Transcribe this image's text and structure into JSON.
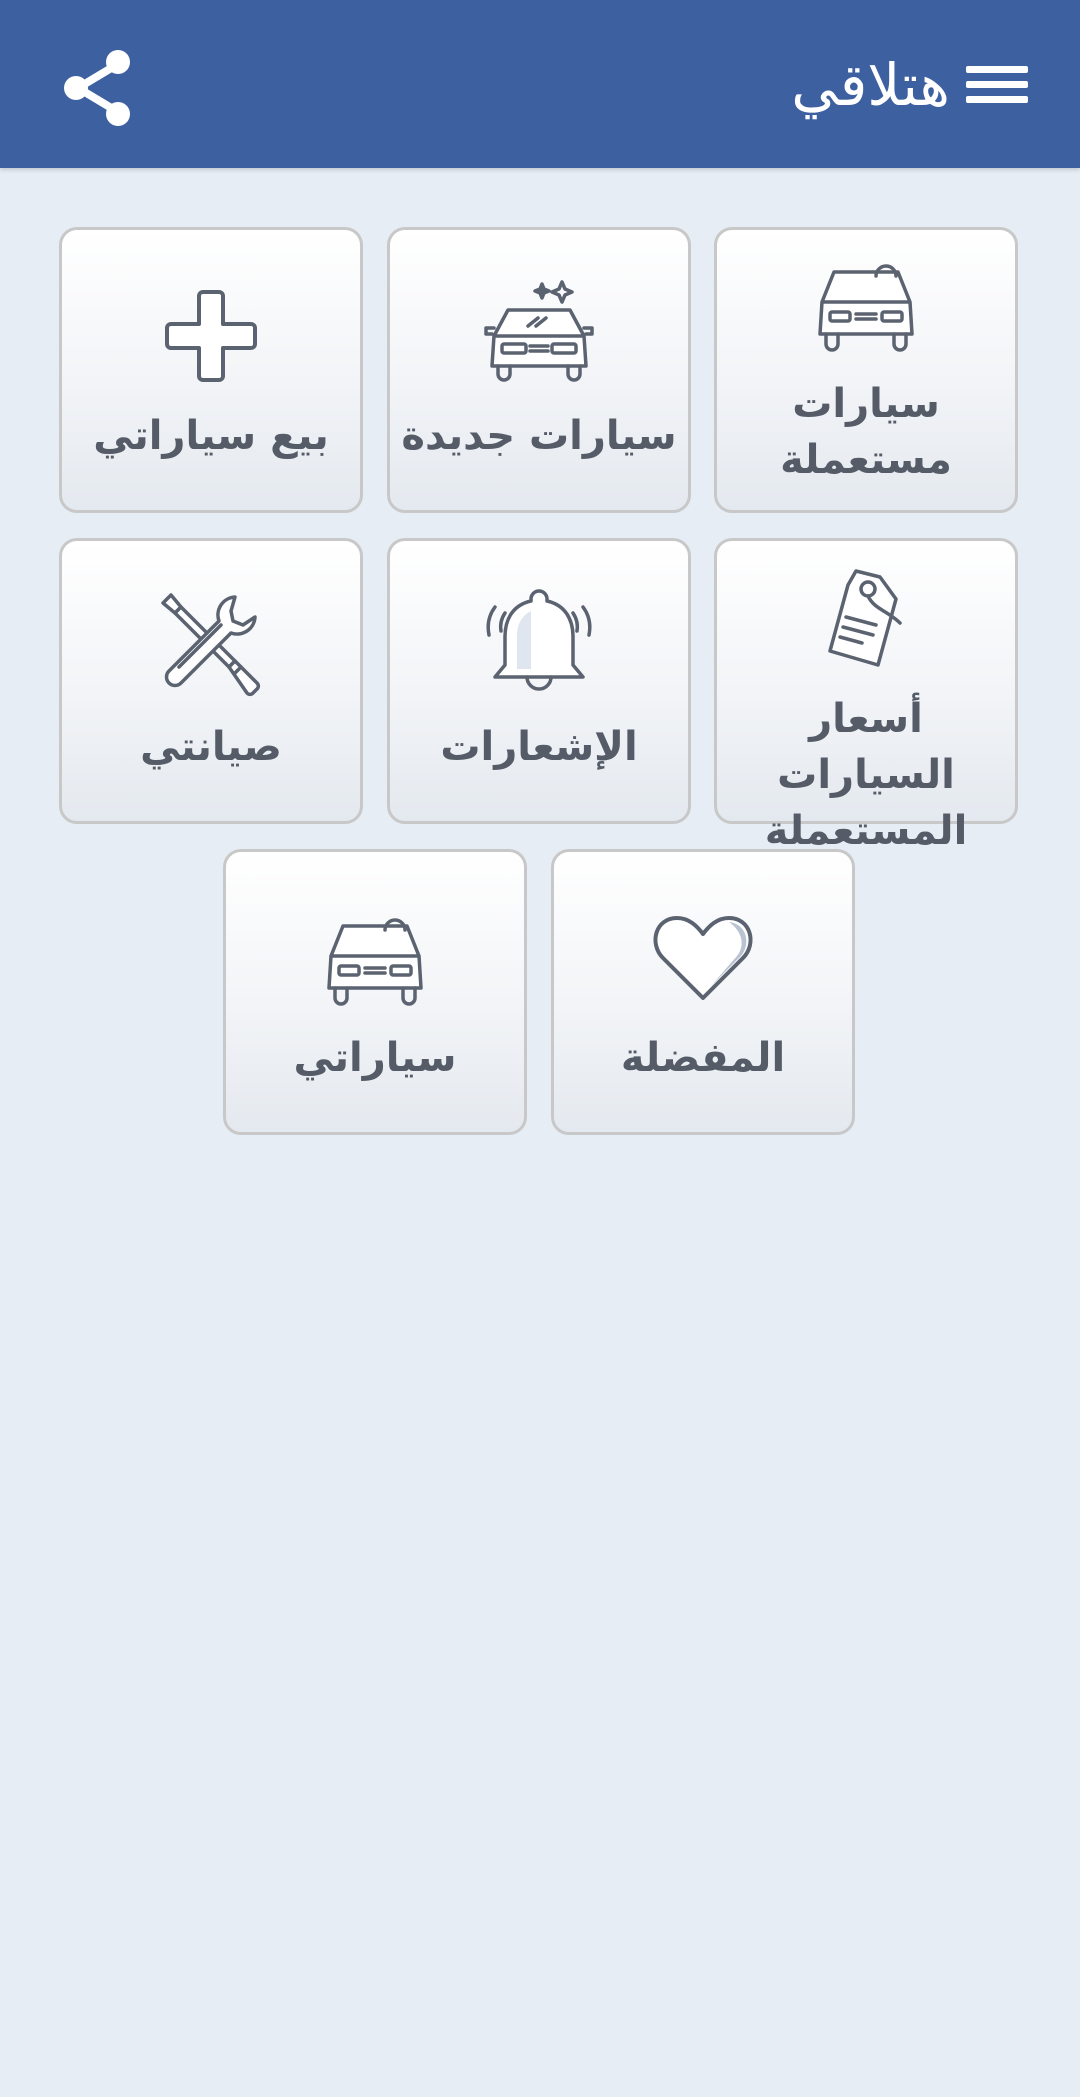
{
  "app": {
    "title": "هتلاقي"
  },
  "header": {
    "menu_icon": "menu-icon",
    "share_icon": "share-icon",
    "colors": {
      "background": "#3d60a0",
      "foreground": "#ffffff"
    }
  },
  "tiles": [
    {
      "label": "سيارات مستعملة",
      "label_line1": "سيارات",
      "label_line2": "مستعملة",
      "icon": "car-icon"
    },
    {
      "label": "سيارات جديدة",
      "icon": "new-car-icon"
    },
    {
      "label": "بيع سياراتي",
      "icon": "plus-icon"
    },
    {
      "label": "أسعار السيارات المستعملة",
      "label_line1": "أسعار السيارات",
      "label_line2": "المستعملة",
      "icon": "price-tag-icon"
    },
    {
      "label": "الإشعارات",
      "icon": "bell-icon"
    },
    {
      "label": "صيانتي",
      "icon": "tools-icon"
    },
    {
      "label": "المفضلة",
      "icon": "heart-icon"
    },
    {
      "label": "سياراتي",
      "icon": "car-icon"
    }
  ],
  "colors": {
    "page_background": "#e6edf5",
    "tile_border": "#c8c8c8",
    "icon_stroke": "#5b6270",
    "label_text": "#555c68"
  }
}
